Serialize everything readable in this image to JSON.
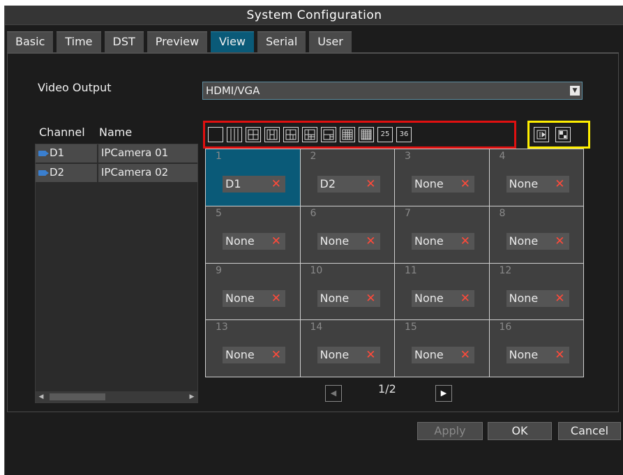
{
  "window": {
    "title": "System Configuration"
  },
  "tabs": [
    {
      "label": "Basic",
      "active": false
    },
    {
      "label": "Time",
      "active": false
    },
    {
      "label": "DST",
      "active": false
    },
    {
      "label": "Preview",
      "active": false
    },
    {
      "label": "View",
      "active": true
    },
    {
      "label": "Serial",
      "active": false
    },
    {
      "label": "User",
      "active": false
    }
  ],
  "video_output": {
    "label": "Video Output",
    "value": "HDMI/VGA"
  },
  "channels": {
    "header_channel": "Channel",
    "header_name": "Name",
    "rows": [
      {
        "channel": "D1",
        "name": "IPCamera 01"
      },
      {
        "channel": "D2",
        "name": "IPCamera 02"
      }
    ]
  },
  "layout_buttons": [
    "1-window",
    "4-column",
    "4-grid",
    "6-grid",
    "8-grid",
    "9-grid-a",
    "9-grid-b",
    "13-grid",
    "16-grid",
    "25",
    "36"
  ],
  "mode_buttons": [
    "sequence-icon",
    "pip-icon"
  ],
  "grid_cells": [
    {
      "num": "1",
      "channel": "D1",
      "selected": true
    },
    {
      "num": "2",
      "channel": "D2",
      "selected": false
    },
    {
      "num": "3",
      "channel": "None",
      "selected": false
    },
    {
      "num": "4",
      "channel": "None",
      "selected": false
    },
    {
      "num": "5",
      "channel": "None",
      "selected": false
    },
    {
      "num": "6",
      "channel": "None",
      "selected": false
    },
    {
      "num": "7",
      "channel": "None",
      "selected": false
    },
    {
      "num": "8",
      "channel": "None",
      "selected": false
    },
    {
      "num": "9",
      "channel": "None",
      "selected": false
    },
    {
      "num": "10",
      "channel": "None",
      "selected": false
    },
    {
      "num": "11",
      "channel": "None",
      "selected": false
    },
    {
      "num": "12",
      "channel": "None",
      "selected": false
    },
    {
      "num": "13",
      "channel": "None",
      "selected": false
    },
    {
      "num": "14",
      "channel": "None",
      "selected": false
    },
    {
      "num": "15",
      "channel": "None",
      "selected": false
    },
    {
      "num": "16",
      "channel": "None",
      "selected": false
    }
  ],
  "pager": {
    "text": "1/2"
  },
  "buttons": {
    "apply": "Apply",
    "ok": "OK",
    "cancel": "Cancel"
  },
  "colors": {
    "active_tab": "#0a5a78",
    "layout_highlight": "#e01010",
    "mode_highlight": "#ffef00",
    "remove_x": "#ff4a3a"
  }
}
